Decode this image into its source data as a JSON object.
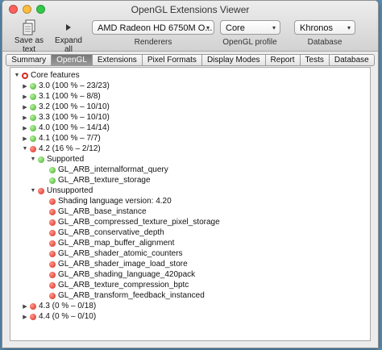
{
  "window": {
    "title": "OpenGL Extensions Viewer"
  },
  "toolbar": {
    "save_as_text": "Save as text",
    "expand_all": "Expand all",
    "renderers": {
      "value": "AMD Radeon HD 6750M O...",
      "caption": "Renderers"
    },
    "profile": {
      "value": "Core",
      "caption": "OpenGL profile"
    },
    "database": {
      "value": "Khronos",
      "caption": "Database"
    }
  },
  "tabs": [
    {
      "label": "Summary",
      "active": false
    },
    {
      "label": "OpenGL",
      "active": true
    },
    {
      "label": "Extensions",
      "active": false
    },
    {
      "label": "Pixel Formats",
      "active": false
    },
    {
      "label": "Display Modes",
      "active": false
    },
    {
      "label": "Report",
      "active": false
    },
    {
      "label": "Tests",
      "active": false
    },
    {
      "label": "Database",
      "active": false
    }
  ],
  "tree": [
    {
      "level": 0,
      "expand": "open",
      "icon": "ring",
      "label": "Core features"
    },
    {
      "level": 1,
      "expand": "closed",
      "icon": "green",
      "label": "3.0 (100 % – 23/23)"
    },
    {
      "level": 1,
      "expand": "closed",
      "icon": "green",
      "label": "3.1 (100 % – 8/8)"
    },
    {
      "level": 1,
      "expand": "closed",
      "icon": "green",
      "label": "3.2 (100 % – 10/10)"
    },
    {
      "level": 1,
      "expand": "closed",
      "icon": "green",
      "label": "3.3 (100 % – 10/10)"
    },
    {
      "level": 1,
      "expand": "closed",
      "icon": "green",
      "label": "4.0 (100 % – 14/14)"
    },
    {
      "level": 1,
      "expand": "closed",
      "icon": "green",
      "label": "4.1 (100 % – 7/7)"
    },
    {
      "level": 1,
      "expand": "open",
      "icon": "red",
      "label": "4.2 (16 % – 2/12)"
    },
    {
      "level": 2,
      "expand": "open",
      "icon": "green",
      "label": "Supported"
    },
    {
      "level": 3,
      "expand": "none",
      "icon": "green",
      "label": "GL_ARB_internalformat_query"
    },
    {
      "level": 3,
      "expand": "none",
      "icon": "green",
      "label": "GL_ARB_texture_storage"
    },
    {
      "level": 2,
      "expand": "open",
      "icon": "red",
      "label": "Unsupported"
    },
    {
      "level": 3,
      "expand": "none",
      "icon": "red",
      "label": "Shading language version: 4.20"
    },
    {
      "level": 3,
      "expand": "none",
      "icon": "red",
      "label": "GL_ARB_base_instance"
    },
    {
      "level": 3,
      "expand": "none",
      "icon": "red",
      "label": "GL_ARB_compressed_texture_pixel_storage"
    },
    {
      "level": 3,
      "expand": "none",
      "icon": "red",
      "label": "GL_ARB_conservative_depth"
    },
    {
      "level": 3,
      "expand": "none",
      "icon": "red",
      "label": "GL_ARB_map_buffer_alignment"
    },
    {
      "level": 3,
      "expand": "none",
      "icon": "red",
      "label": "GL_ARB_shader_atomic_counters"
    },
    {
      "level": 3,
      "expand": "none",
      "icon": "red",
      "label": "GL_ARB_shader_image_load_store"
    },
    {
      "level": 3,
      "expand": "none",
      "icon": "red",
      "label": "GL_ARB_shading_language_420pack"
    },
    {
      "level": 3,
      "expand": "none",
      "icon": "red",
      "label": "GL_ARB_texture_compression_bptc"
    },
    {
      "level": 3,
      "expand": "none",
      "icon": "red",
      "label": "GL_ARB_transform_feedback_instanced"
    },
    {
      "level": 1,
      "expand": "closed",
      "icon": "red",
      "label": "4.3 (0 % – 0/18)"
    },
    {
      "level": 1,
      "expand": "closed",
      "icon": "red",
      "label": "4.4 (0 % – 0/10)"
    }
  ],
  "colors": {
    "supported": "#3fae28",
    "unsupported": "#d8281d",
    "active_tab": "#888888"
  }
}
